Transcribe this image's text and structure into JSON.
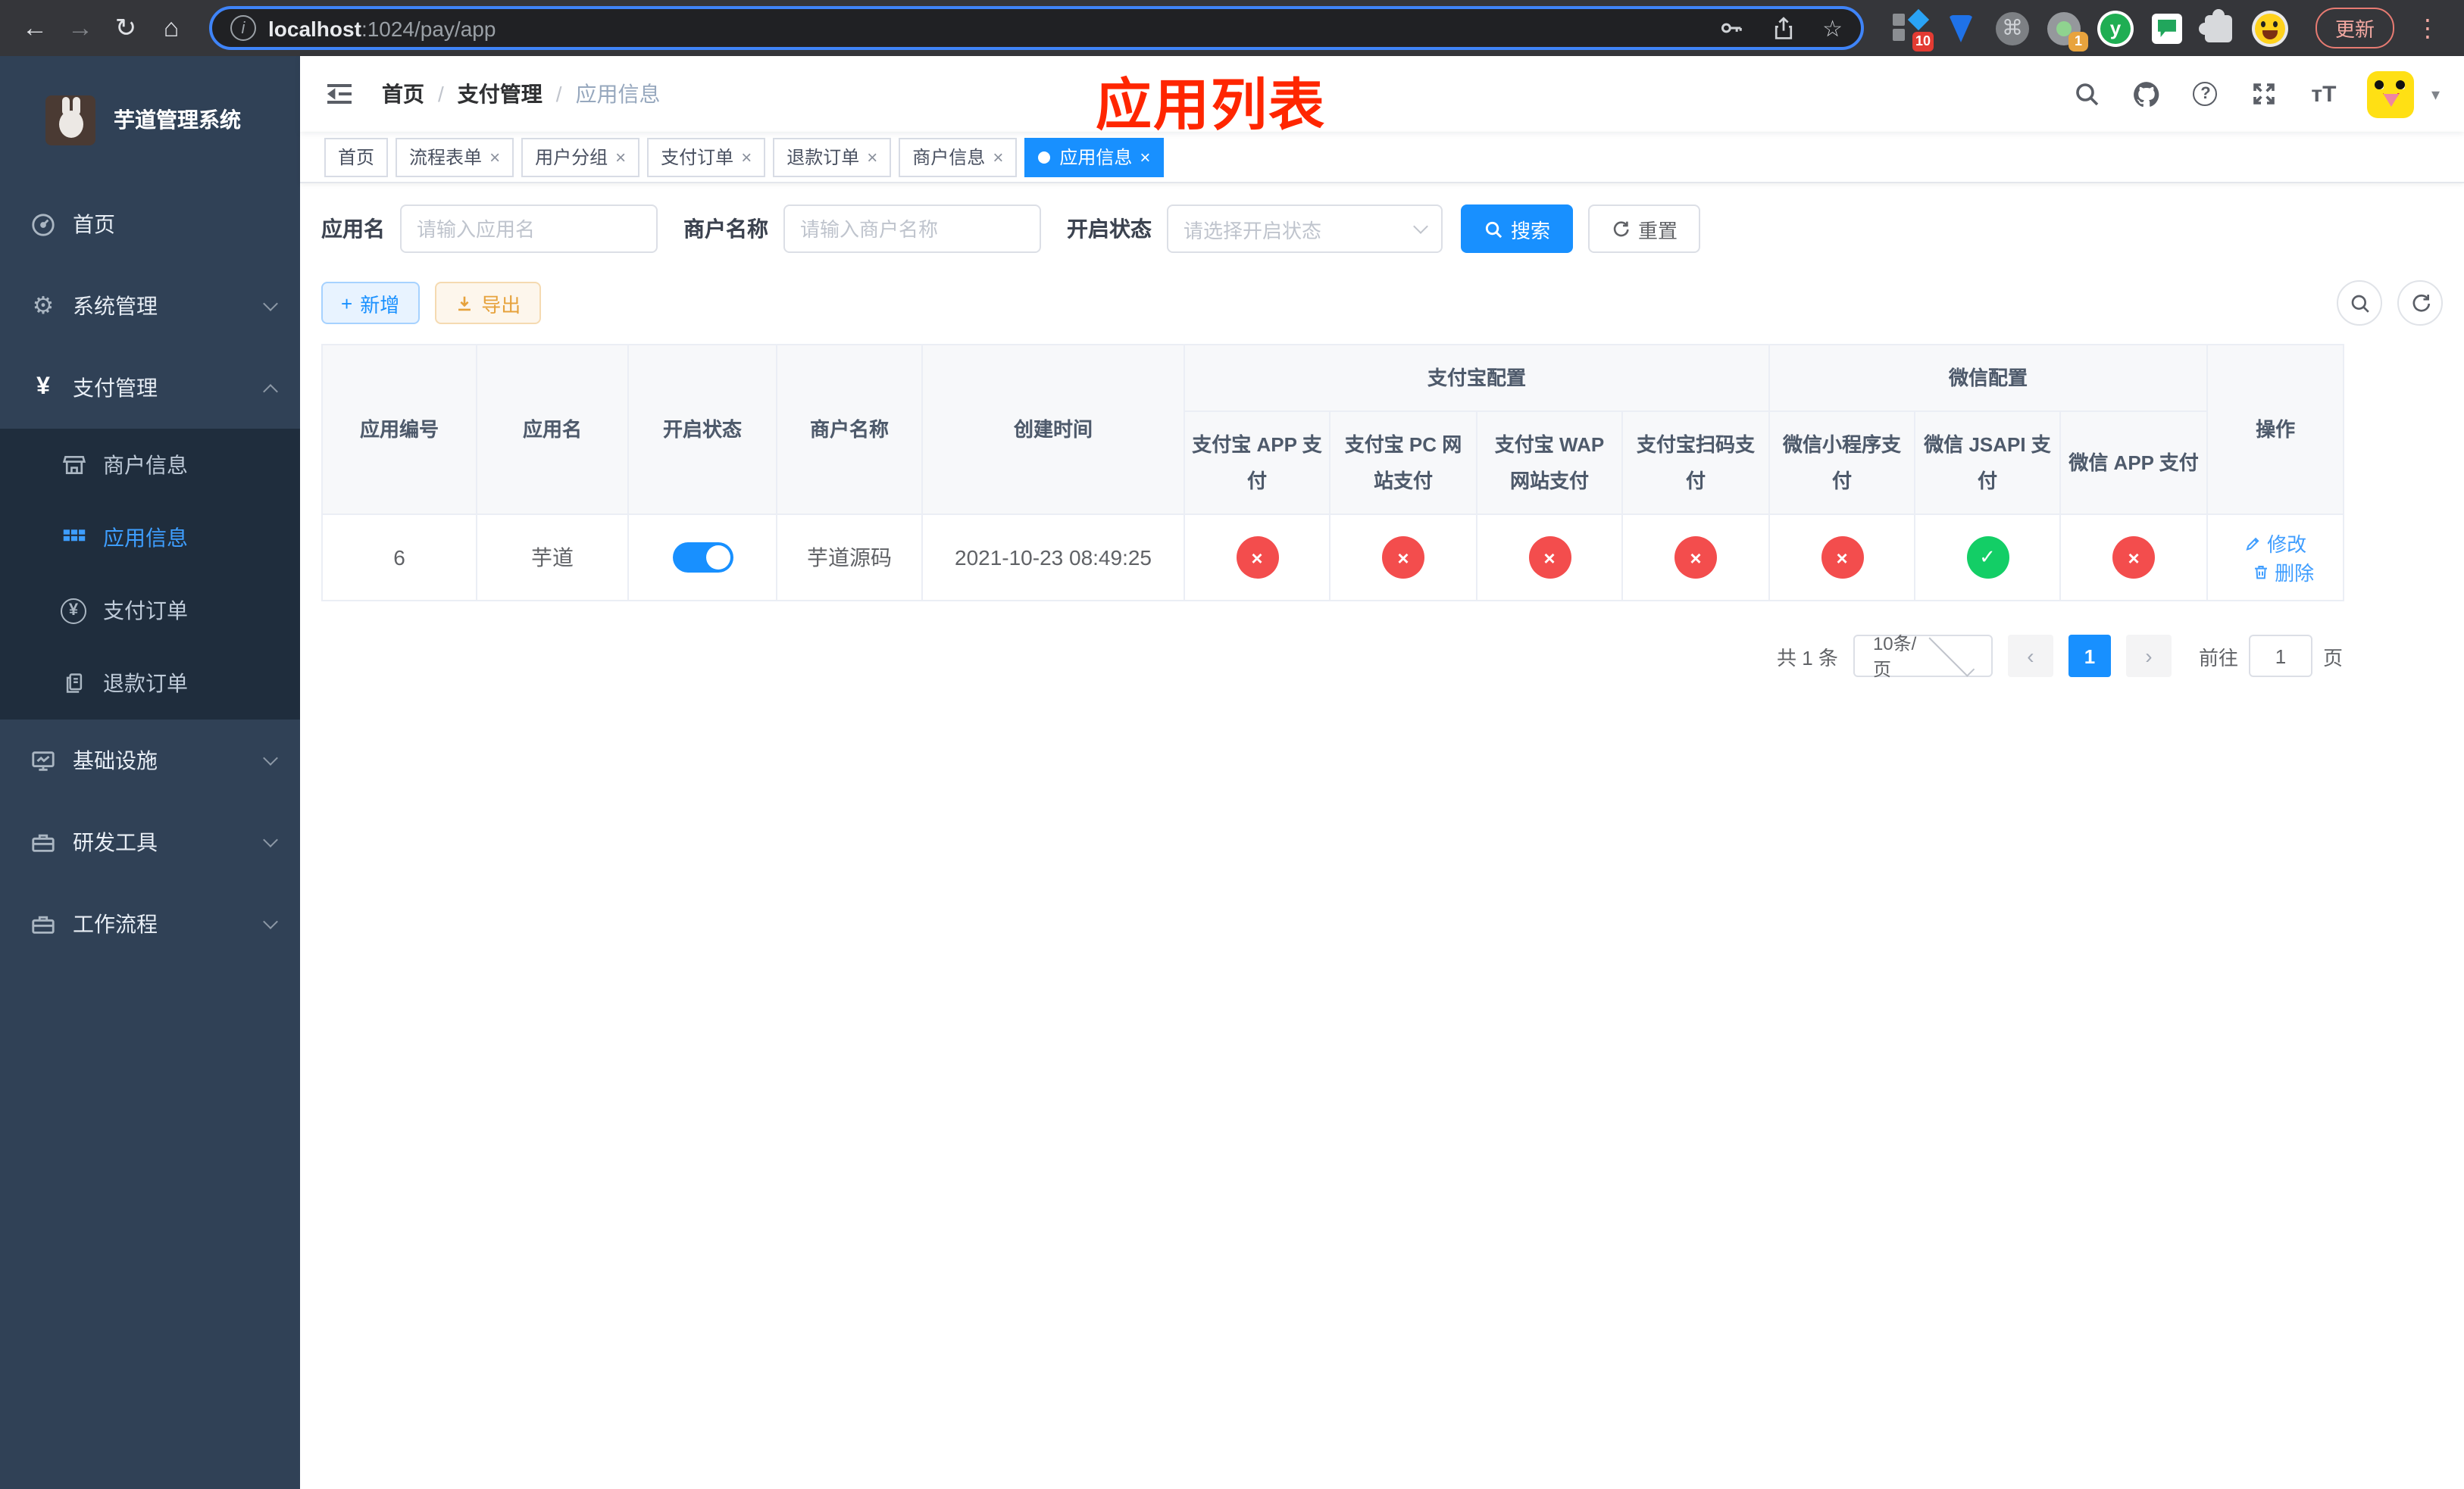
{
  "browser": {
    "url_host": "localhost",
    "url_path": ":1024/pay/app",
    "update_button": "更新",
    "ext_badge_10": "10",
    "ext_badge_1": "1",
    "ext_y": "y"
  },
  "glyphs": {
    "back": "←",
    "forward": "→",
    "reload": "↻",
    "home": "⌂",
    "info": "i",
    "star": "☆",
    "cmd": "⌘",
    "kebab": "⋮",
    "slash": "/",
    "close": "×",
    "caret_down": "▾",
    "question": "?",
    "tt": "тT",
    "plus": "+",
    "yen": "¥",
    "prev": "‹",
    "next": "›",
    "gear": "⚙"
  },
  "sidebar": {
    "title": "芋道管理系统",
    "menu": [
      {
        "label": "首页"
      },
      {
        "label": "系统管理"
      },
      {
        "label": "支付管理"
      },
      {
        "label": "基础设施"
      },
      {
        "label": "研发工具"
      },
      {
        "label": "工作流程"
      }
    ],
    "submenu": [
      {
        "label": "商户信息"
      },
      {
        "label": "应用信息"
      },
      {
        "label": "支付订单"
      },
      {
        "label": "退款订单"
      }
    ]
  },
  "navbar": {
    "breadcrumb": {
      "home": "首页",
      "parent": "支付管理",
      "current": "应用信息"
    },
    "annotation": "应用列表"
  },
  "tags": [
    {
      "label": "首页"
    },
    {
      "label": "流程表单"
    },
    {
      "label": "用户分组"
    },
    {
      "label": "支付订单"
    },
    {
      "label": "退款订单"
    },
    {
      "label": "商户信息"
    },
    {
      "label": "应用信息"
    }
  ],
  "search": {
    "name_label": "应用名",
    "name_placeholder": "请输入应用名",
    "merchant_label": "商户名称",
    "merchant_placeholder": "请输入商户名称",
    "status_label": "开启状态",
    "status_placeholder": "请选择开启状态",
    "search_button": "搜索",
    "reset_button": "重置"
  },
  "toolbar": {
    "add": "新增",
    "export": "导出"
  },
  "table": {
    "headers": {
      "id": "应用编号",
      "name": "应用名",
      "status": "开启状态",
      "merchant": "商户名称",
      "created": "创建时间",
      "alipay_group": "支付宝配置",
      "wechat_group": "微信配置",
      "alipay_app": "支付宝 APP 支付",
      "alipay_pc": "支付宝 PC 网站支付",
      "alipay_wap": "支付宝 WAP 网站支付",
      "alipay_qr": "支付宝扫码支付",
      "wx_mini": "微信小程序支付",
      "wx_jsapi": "微信 JSAPI 支付",
      "wx_app": "微信 APP 支付",
      "ops": "操作"
    },
    "row": {
      "id": "6",
      "name": "芋道",
      "enabled": "on",
      "merchant": "芋道源码",
      "created": "2021-10-23 08:49:25",
      "statuses": {
        "alipay_app": {
          "state": "fail",
          "glyph": "×"
        },
        "alipay_pc": {
          "state": "fail",
          "glyph": "×"
        },
        "alipay_wap": {
          "state": "fail",
          "glyph": "×"
        },
        "alipay_qr": {
          "state": "fail",
          "glyph": "×"
        },
        "wx_mini": {
          "state": "fail",
          "glyph": "×"
        },
        "wx_jsapi": {
          "state": "success",
          "glyph": "✓"
        },
        "wx_app": {
          "state": "fail",
          "glyph": "×"
        }
      }
    },
    "ops": {
      "edit": "修改",
      "del": "删除"
    }
  },
  "pagination": {
    "total": "共 1 条",
    "page_size": "10条/页",
    "current_page": "1",
    "goto_label": "前往",
    "goto_value": "1",
    "page_unit": "页"
  },
  "colors": {
    "primary": "#1890ff",
    "danger": "#f34d4d",
    "success": "#13ce66",
    "warning": "#e6a23c",
    "sidebar_bg": "#304156",
    "submenu_bg": "#1f2d3d",
    "annotation": "#ff2600"
  }
}
